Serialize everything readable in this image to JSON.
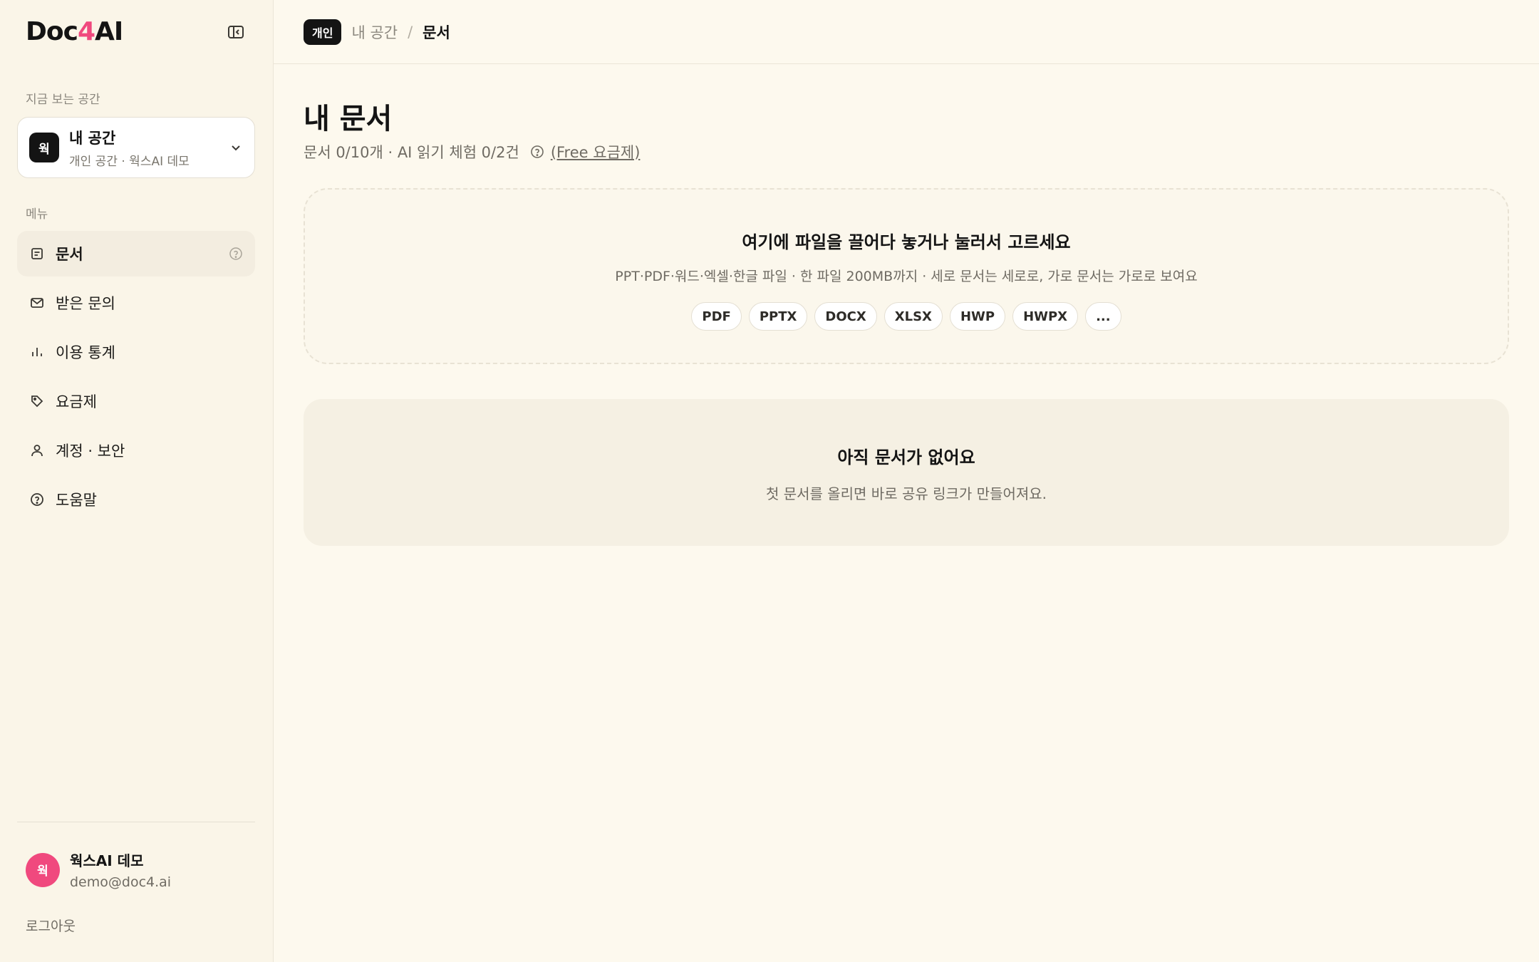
{
  "brand": {
    "logo_left": "Doc",
    "logo_mid": "4",
    "logo_right": "AI",
    "accent_color": "#f0497e"
  },
  "sidebar": {
    "workspace_section_label": "지금 보는 공간",
    "workspace": {
      "avatar": "웍",
      "name": "내 공간",
      "subtitle": "개인 공간 · 웍스AI 데모"
    },
    "menu_section_label": "메뉴",
    "items": [
      {
        "label": "문서",
        "icon": "document-icon",
        "active": true
      },
      {
        "label": "받은 문의",
        "icon": "mail-icon"
      },
      {
        "label": "이용 통계",
        "icon": "bar-chart-icon"
      },
      {
        "label": "요금제",
        "icon": "tag-icon"
      },
      {
        "label": "계정 · 보안",
        "icon": "user-icon"
      },
      {
        "label": "도움말",
        "icon": "help-circle-icon"
      }
    ],
    "user": {
      "avatar": "웍",
      "name": "웍스AI 데모",
      "email": "demo@doc4.ai"
    },
    "logout_label": "로그아웃"
  },
  "header": {
    "badge": "개인",
    "breadcrumb": [
      "내 공간",
      "문서"
    ],
    "separator": "/"
  },
  "main": {
    "title": "내 문서",
    "subtitle": "문서 0/10개 · AI 읽기 체험 0/2건",
    "plan_link": "(Free 요금제)",
    "dropzone": {
      "title": "여기에 파일을 끌어다 놓거나 눌러서 고르세요",
      "subtitle": "PPT·PDF·워드·엑셀·한글 파일 · 한 파일 200MB까지 · 세로 문서는 세로로, 가로 문서는 가로로 보여요",
      "formats": [
        "PDF",
        "PPTX",
        "DOCX",
        "XLSX",
        "HWP",
        "HWPX",
        "..."
      ]
    },
    "empty": {
      "title": "아직 문서가 없어요",
      "subtitle": "첫 문서를 올리면 바로 공유 링크가 만들어져요."
    }
  }
}
